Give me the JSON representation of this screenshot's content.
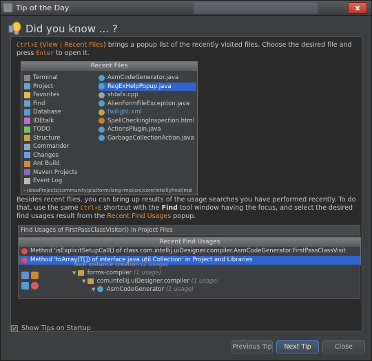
{
  "window": {
    "title": "Tip of the Day",
    "close_label": "x"
  },
  "header": {
    "title": "Did you know ... ?"
  },
  "tip": {
    "p1_kbd": "Ctrl+E",
    "p1_open": " (",
    "p1_view": "View",
    "p1_sep": " | ",
    "p1_recent": "Recent Files",
    "p1_close": ")",
    "p1_text1": " brings a popup list of the recently visited files. Choose the desired file and press ",
    "p1_kbd2": "Enter",
    "p1_text2": " to open it.",
    "p2_text1": "Besides recent files, you can bring up results of the usage searches you have performed recently. To do that, use the same ",
    "p2_kbd": "Ctrl+E",
    "p2_text2": " shortcut with the ",
    "p2_find": "Find",
    "p2_text3": " tool window having the focus, and select the desired find usages result from the ",
    "p2_recent": "Recent Find Usages",
    "p2_text4": " popup."
  },
  "recent_files_popup": {
    "title": "Recent Files",
    "tool_windows": [
      "Terminal",
      "Project",
      "Favorites",
      "Find",
      "Database",
      "IDEtalk",
      "TODO",
      "Structure",
      "Commander",
      "Changes",
      "Ant Build",
      "Maven Projects",
      "Event Log"
    ],
    "files": [
      {
        "name": "AsmCodeGenerator.java",
        "style": "normal"
      },
      {
        "name": "RegExHelpPopup.java",
        "style": "selected"
      },
      {
        "name": "stdafx.cpp",
        "style": "normal"
      },
      {
        "name": "AlienFormFileException.java",
        "style": "normal"
      },
      {
        "name": "twilight.xml",
        "style": "blue"
      },
      {
        "name": "SpellCheckingInspection.html",
        "style": "normal"
      },
      {
        "name": "ActionsPlugin.java",
        "style": "normal"
      },
      {
        "name": "GarbageCollectionAction.java",
        "style": "normal"
      }
    ],
    "path": "~/IdeaProjects/community/platform/lang-impl/src/com/intellij/find/impl"
  },
  "find_usages": {
    "title": "Find Usages of FirstPassClassVisitor() in Project Files",
    "popup_title": "Recent Find Usages",
    "results": [
      {
        "text": "Method 'isExplicitSetupCall() of class com.intellij.uiDesigner.compiler.AsmCodeGenerator.FirstPassClassVisit",
        "selected": false
      },
      {
        "text": "Method 'toArray(T[]) of interface java.util.Collection' in Project and Libraries",
        "selected": true
      }
    ],
    "tree": {
      "row0": "New instance creation",
      "row0_count": "(1 usage)",
      "row1": "forms-compiler",
      "row1_count": "(1 usage)",
      "row2": "com.intellij.uiDesigner.compiler",
      "row2_count": "(1 usage)",
      "row3": "AsmCodeGenerator",
      "row3_count": "(1 usage)"
    }
  },
  "footer": {
    "show_tips_label": "Show Tips on Startup",
    "show_tips_checked": true,
    "checkmark": "✓",
    "prev_button": "Previous Tip",
    "next_button": "Next Tip",
    "close_button": "Close"
  },
  "colors": {
    "accent": "#e08a3c",
    "selection": "#2f65ca",
    "link_blue": "#6b9edb"
  }
}
